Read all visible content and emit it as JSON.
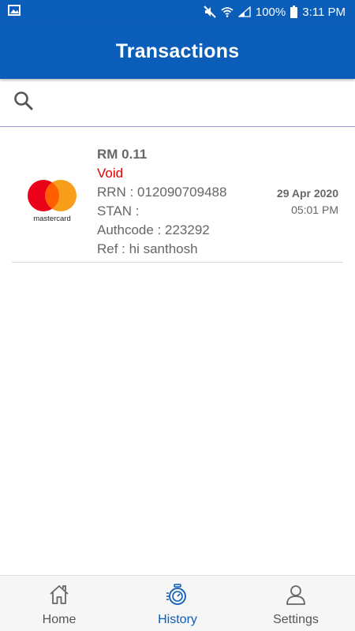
{
  "status_bar": {
    "battery": "100%",
    "time": "3:11 PM"
  },
  "header": {
    "title": "Transactions"
  },
  "search": {
    "placeholder": ""
  },
  "transactions": [
    {
      "card_brand": "mastercard",
      "amount": "RM 0.11",
      "status": "Void",
      "rrn": "RRN : 012090709488",
      "stan": "STAN :",
      "authcode": "Authcode : 223292",
      "ref": "Ref : hi santhosh",
      "date": "29 Apr 2020",
      "time": "05:01 PM"
    }
  ],
  "bottom_nav": {
    "items": [
      {
        "label": "Home",
        "icon": "home-icon",
        "active": false
      },
      {
        "label": "History",
        "icon": "history-icon",
        "active": true
      },
      {
        "label": "Settings",
        "icon": "person-icon",
        "active": false
      }
    ]
  },
  "colors": {
    "primary": "#0a5db8",
    "void": "#e00000",
    "mastercard_red": "#eb001b",
    "mastercard_yellow": "#f79e1b"
  }
}
